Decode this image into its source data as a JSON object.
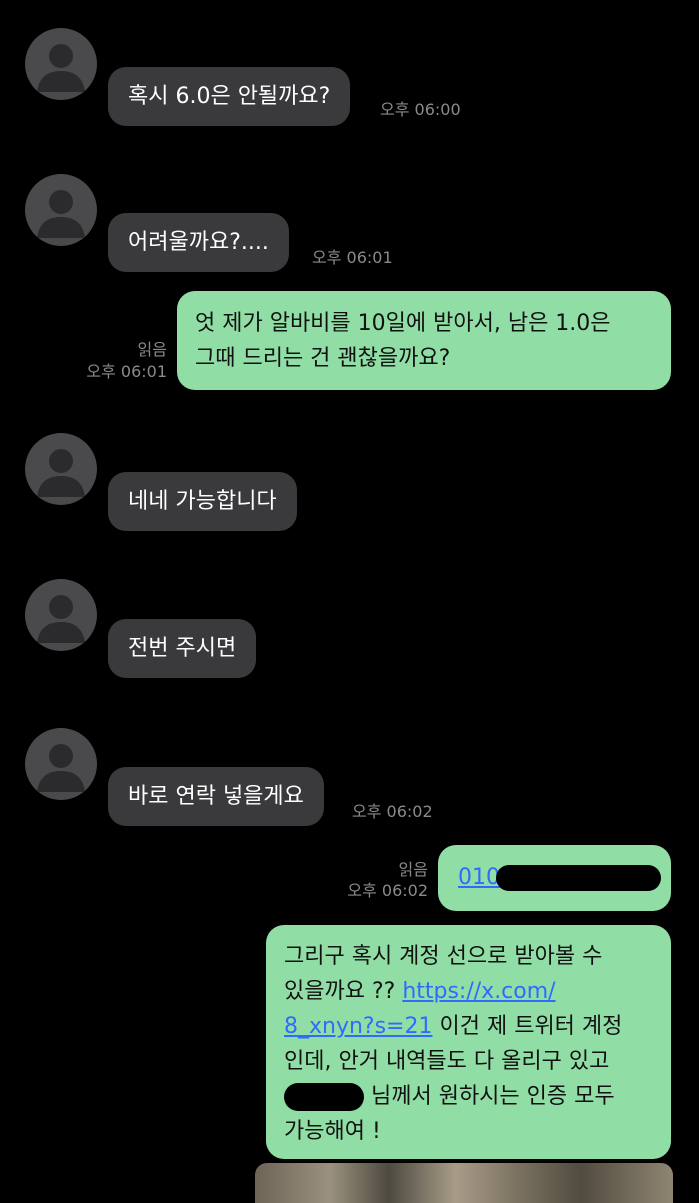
{
  "messages": [
    {
      "text": "혹시 6.0은 안될까요?",
      "time": "오후 06:00"
    },
    {
      "text": "어려울까요?....",
      "time": "오후 06:01"
    },
    {
      "lines": [
        "엇 제가 알바비를 10일에 받아서, 남은 1.0은",
        "그때 드리는 건 괜찮을까요?"
      ],
      "read": "읽음",
      "time": "오후 06:01"
    },
    {
      "text": "네네 가능합니다"
    },
    {
      "text": "전번 주시면"
    },
    {
      "text": "바로 연락 넣을게요",
      "time": "오후 06:02"
    },
    {
      "link_prefix": "010",
      "read": "읽음",
      "time": "오후 06:02"
    },
    {
      "line1": "그리구 혹시 계정 선으로 받아볼 수",
      "line2_text": "있을까요 ?? ",
      "line2_link": "https://x.com/",
      "line3_link": "8_xnyn?s=21",
      "line3_text": " 이건 제 트위터 계정",
      "line4": "인데, 안거 내역들도 다 올리구 있고",
      "line5_text": " 님께서 원하시는 인증 모두",
      "line6": "가능해여 !"
    }
  ],
  "colors": {
    "incoming_bubble": "#3a3a3d",
    "outgoing_bubble": "#90dea5",
    "link": "#2f6bff",
    "background": "#000000"
  },
  "icons": {
    "avatar": "person-silhouette-icon"
  }
}
